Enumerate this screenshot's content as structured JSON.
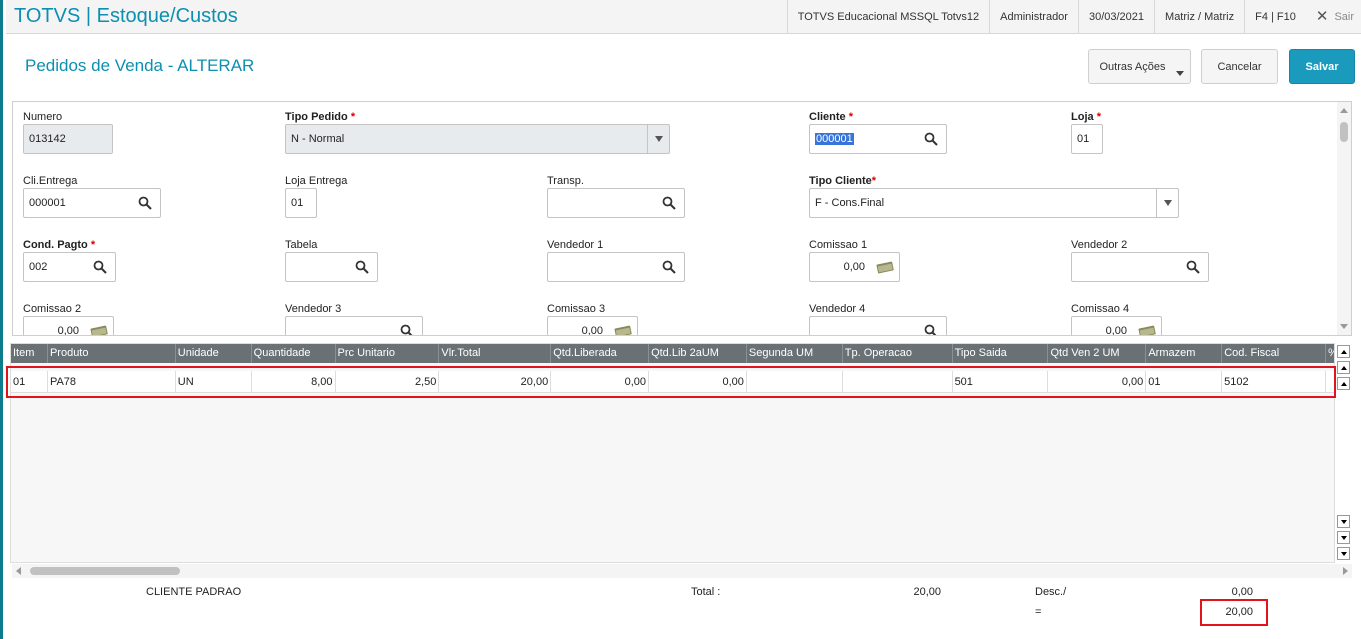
{
  "header": {
    "app_title": "TOTVS | Estoque/Custos",
    "environment": "TOTVS Educacional MSSQL Totvs12",
    "user": "Administrador",
    "date": "30/03/2021",
    "branch": "Matriz / Matriz",
    "shortcuts": "F4 | F10",
    "exit_label": "Sair"
  },
  "page": {
    "title": "Pedidos de Venda - ALTERAR",
    "other_actions_label": "Outras Ações",
    "cancel_label": "Cancelar",
    "save_label": "Salvar"
  },
  "form": {
    "numero": {
      "label": "Numero",
      "value": "013142"
    },
    "tipo_pedido": {
      "label": "Tipo Pedido",
      "value": "N - Normal"
    },
    "cliente": {
      "label": "Cliente",
      "value": "000001"
    },
    "loja": {
      "label": "Loja",
      "value": "01"
    },
    "cli_entrega": {
      "label": "Cli.Entrega",
      "value": "000001"
    },
    "loja_entrega": {
      "label": "Loja Entrega",
      "value": "01"
    },
    "transp": {
      "label": "Transp.",
      "value": ""
    },
    "tipo_cliente": {
      "label": "Tipo Cliente",
      "value": "F - Cons.Final"
    },
    "cond_pagto": {
      "label": "Cond. Pagto",
      "value": "002"
    },
    "tabela": {
      "label": "Tabela",
      "value": ""
    },
    "vendedor1": {
      "label": "Vendedor 1",
      "value": ""
    },
    "comissao1": {
      "label": "Comissao 1",
      "value": "0,00"
    },
    "vendedor2": {
      "label": "Vendedor 2",
      "value": ""
    },
    "comissao2": {
      "label": "Comissao 2",
      "value": "0,00"
    },
    "vendedor3": {
      "label": "Vendedor 3",
      "value": ""
    },
    "comissao3": {
      "label": "Comissao 3",
      "value": "0,00"
    },
    "vendedor4": {
      "label": "Vendedor 4",
      "value": ""
    },
    "comissao4": {
      "label": "Comissao 4",
      "value": "0,00"
    },
    "required_mark": "*"
  },
  "grid": {
    "columns": [
      "Item",
      "Produto",
      "Unidade",
      "Quantidade",
      "Prc Unitario",
      "Vlr.Total",
      "Qtd.Liberada",
      "Qtd.Lib 2aUM",
      "Segunda UM",
      "Tp. Operacao",
      "Tipo Saida",
      "Qtd Ven 2 UM",
      "Armazem",
      "Cod. Fiscal",
      "%"
    ],
    "rows": [
      [
        "01",
        "PA78",
        "UN",
        "8,00",
        "2,50",
        "20,00",
        "0,00",
        "0,00",
        "",
        "",
        "501",
        "0,00",
        "01",
        "5102",
        ""
      ]
    ]
  },
  "footer": {
    "client_name": "CLIENTE PADRAO",
    "total_label": "Total :",
    "total_value": "20,00",
    "desc_label": "Desc./",
    "desc_value": "0,00",
    "equals_label": "=",
    "final_value": "20,00"
  },
  "colors": {
    "accent": "#0c8fb0",
    "save_button": "#1a9bbd",
    "grid_header": "#6a7175",
    "highlight_border": "#e1141b"
  }
}
